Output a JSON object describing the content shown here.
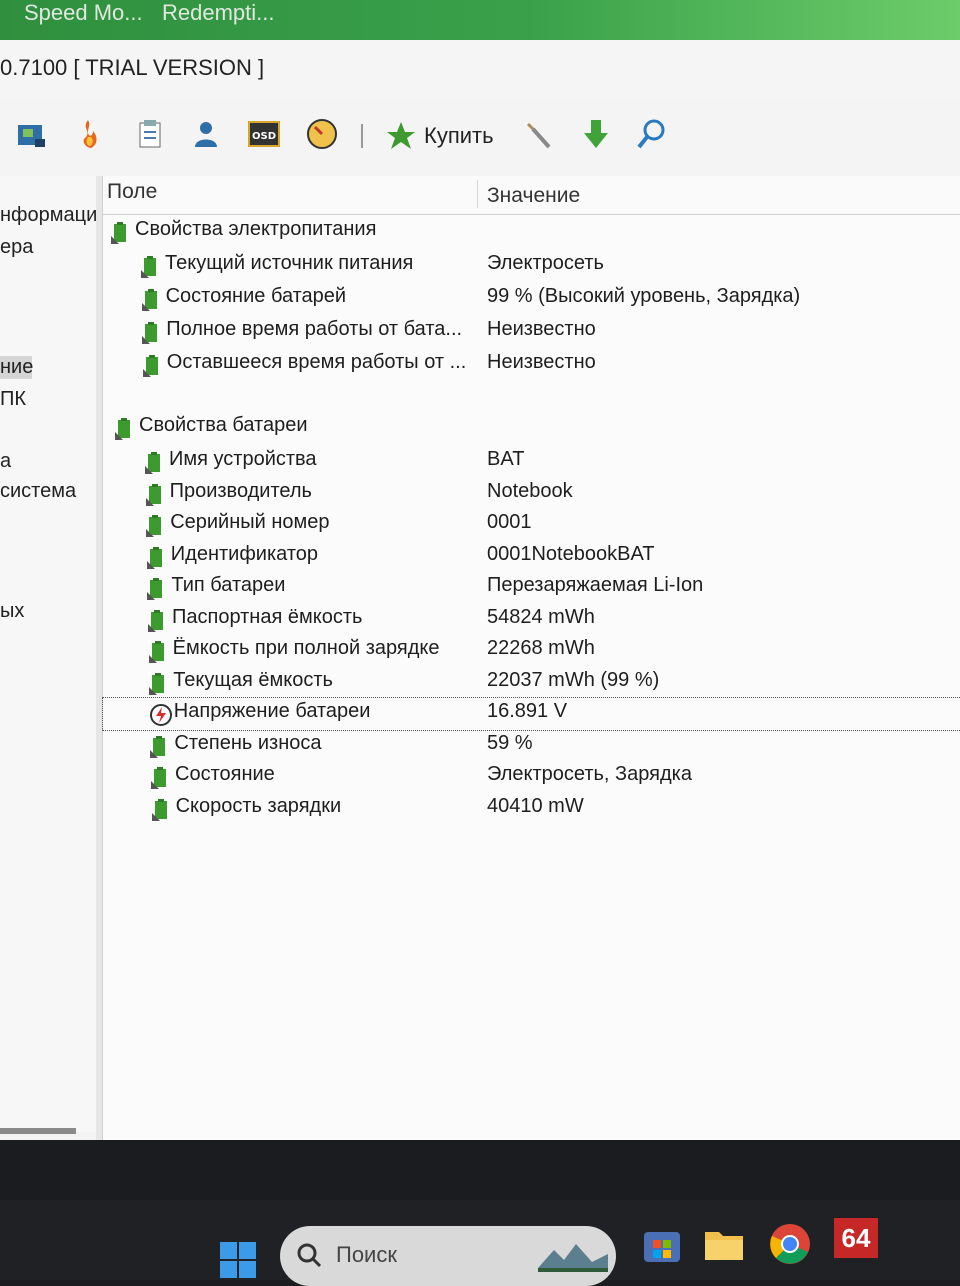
{
  "window_tabs": [
    "Speed Mo...",
    "Redempti..."
  ],
  "title": "0.7100  [ TRIAL VERSION ]",
  "toolbar": {
    "buttons": [
      "board-icon",
      "flame-icon",
      "report-icon",
      "user-icon",
      "osd-icon",
      "gauge-icon"
    ],
    "buy_label": "Купить",
    "tools": [
      "wrench-icon",
      "download-arrow-icon",
      "search-icon"
    ],
    "osd_text": "OSD"
  },
  "left_nav": {
    "items": [
      "нформаци",
      "ера",
      "ние",
      "ПК",
      "а",
      "система",
      "ых"
    ],
    "selected_index": 2
  },
  "columns": {
    "field": "Поле",
    "value": "Значение"
  },
  "power_properties": {
    "header": "Свойства электропитания",
    "rows": [
      {
        "field": "Текущий источник питания",
        "value": "Электросеть"
      },
      {
        "field": "Состояние батарей",
        "value": "99 % (Высокий уровень, Зарядка)"
      },
      {
        "field": "Полное время работы от бата...",
        "value": "Неизвестно"
      },
      {
        "field": "Оставшееся время работы от ...",
        "value": "Неизвестно"
      }
    ]
  },
  "battery_properties": {
    "header": "Свойства батареи",
    "rows": [
      {
        "field": "Имя устройства",
        "value": "BAT"
      },
      {
        "field": "Производитель",
        "value": "Notebook"
      },
      {
        "field": "Серийный номер",
        "value": "0001"
      },
      {
        "field": "Идентификатор",
        "value": "0001NotebookBAT"
      },
      {
        "field": "Тип батареи",
        "value": "Перезаряжаемая Li-Ion"
      },
      {
        "field": "Паспортная ёмкость",
        "value": "54824 mWh"
      },
      {
        "field": "Ёмкость при полной зарядке",
        "value": "22268 mWh"
      },
      {
        "field": "Текущая ёмкость",
        "value": "22037 mWh  (99 %)"
      },
      {
        "field": "Напряжение батареи",
        "value": "16.891 V"
      },
      {
        "field": "Степень износа",
        "value": "59 %"
      },
      {
        "field": "Состояние",
        "value": "Электросеть, Зарядка"
      },
      {
        "field": "Скорость зарядки",
        "value": "40410 mW"
      }
    ]
  },
  "taskbar": {
    "search_placeholder": "Поиск",
    "app_badge": "64",
    "apps": [
      "windows-start-icon",
      "store-icon",
      "file-explorer-icon",
      "chrome-icon",
      "aida64-icon"
    ]
  },
  "colors": {
    "battery_green": "#3c9a2e",
    "accent_green": "#3aa14a",
    "taskbar": "#202124"
  }
}
